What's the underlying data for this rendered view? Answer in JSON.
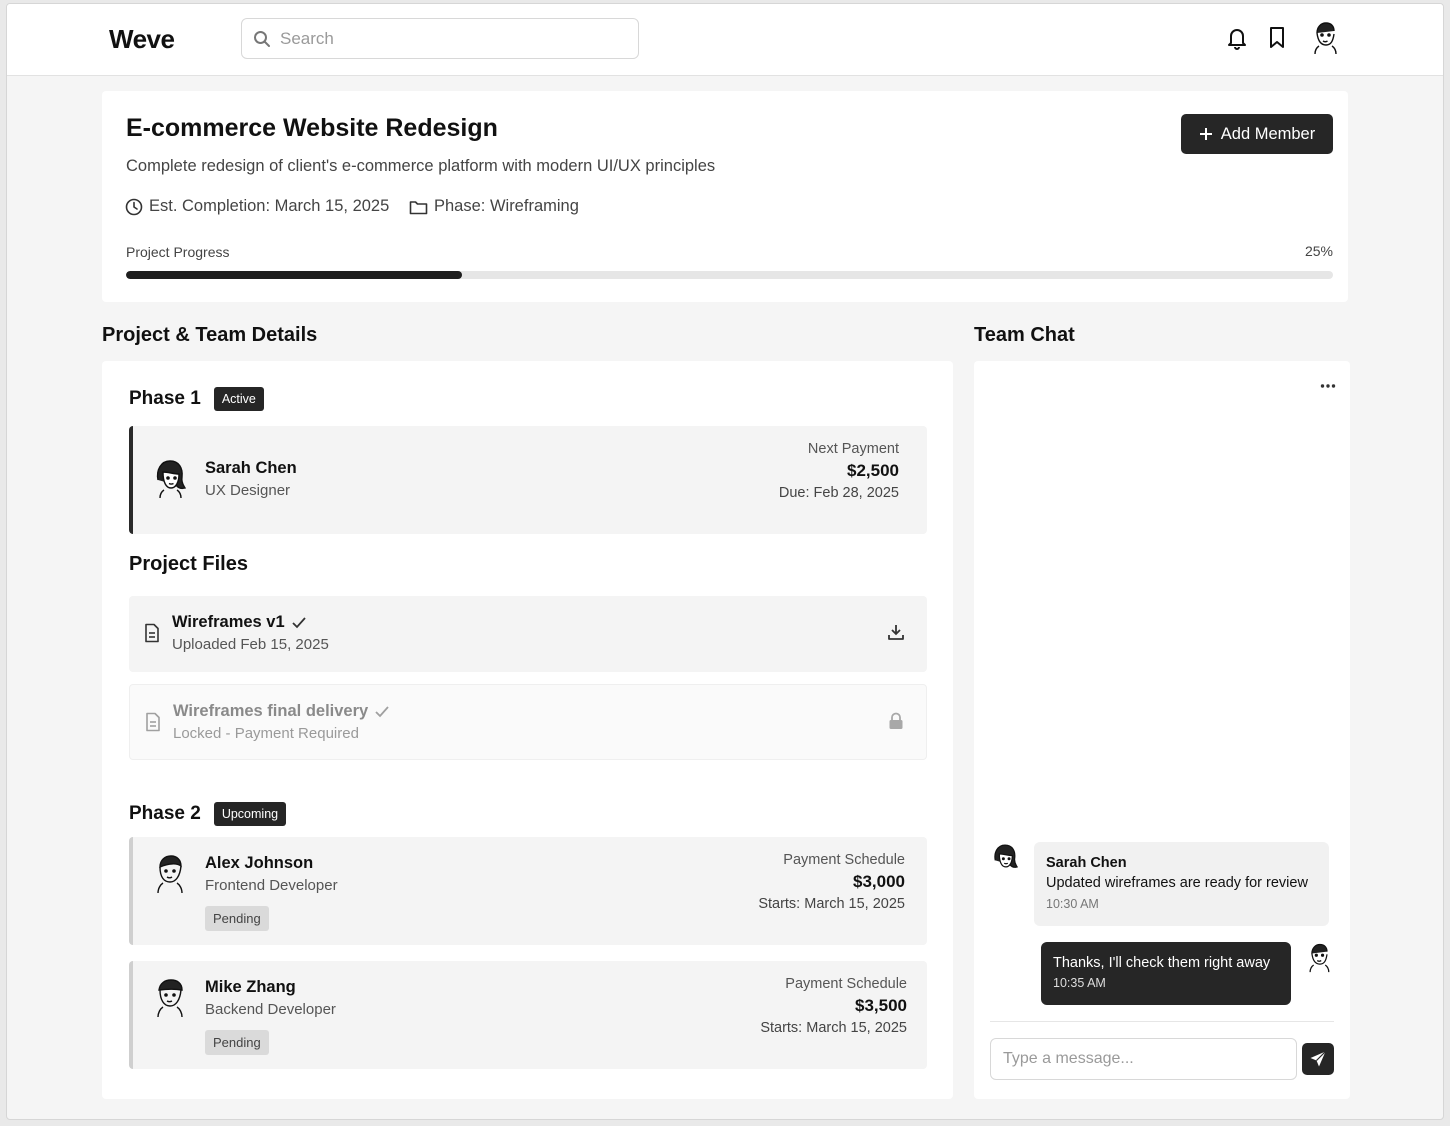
{
  "header": {
    "logo": "Weve",
    "search_placeholder": "Search",
    "icons": [
      "bell-icon",
      "bookmark-icon",
      "user-avatar"
    ]
  },
  "project": {
    "title": "E-commerce Website Redesign",
    "description": "Complete redesign of client's e-commerce platform with modern UI/UX principles",
    "completion": "Est. Completion: March 15, 2025",
    "phase": "Phase: Wireframing",
    "add_member_label": "Add Member",
    "progress_label": "Project Progress",
    "progress_text": "25%",
    "progress_value": 0.25
  },
  "details": {
    "section_title": "Project & Team Details",
    "phase1": {
      "title": "Phase 1",
      "badge": "Active",
      "member": {
        "name": "Sarah Chen",
        "role": "UX Designer",
        "pay_label": "Next Payment",
        "amount": "$2,500",
        "due": "Due: Feb 28, 2025"
      }
    },
    "files": {
      "title": "Project Files",
      "items": [
        {
          "name": "Wireframes v1",
          "sub": "Uploaded Feb 15, 2025"
        },
        {
          "name": "Wireframes final delivery",
          "sub": "Locked - Payment Required"
        }
      ]
    },
    "phase2": {
      "title": "Phase 2",
      "badge": "Upcoming",
      "members": [
        {
          "name": "Alex Johnson",
          "role": "Frontend Developer",
          "status": "Pending",
          "pay_label": "Payment Schedule",
          "amount": "$3,000",
          "starts": "Starts: March 15, 2025"
        },
        {
          "name": "Mike Zhang",
          "role": "Backend Developer",
          "status": "Pending",
          "pay_label": "Payment Schedule",
          "amount": "$3,500",
          "starts": "Starts: March 15, 2025"
        }
      ]
    }
  },
  "chat": {
    "title": "Team Chat",
    "messages": [
      {
        "sender": "Sarah Chen",
        "text": "Updated wireframes are ready for review",
        "time": "10:30 AM"
      },
      {
        "text": "Thanks, I'll check them right away",
        "time": "10:35 AM"
      }
    ],
    "input_placeholder": "Type a message..."
  },
  "colors": {
    "accent": "#262626",
    "background": "#f5f5f5",
    "card": "#ffffff"
  }
}
